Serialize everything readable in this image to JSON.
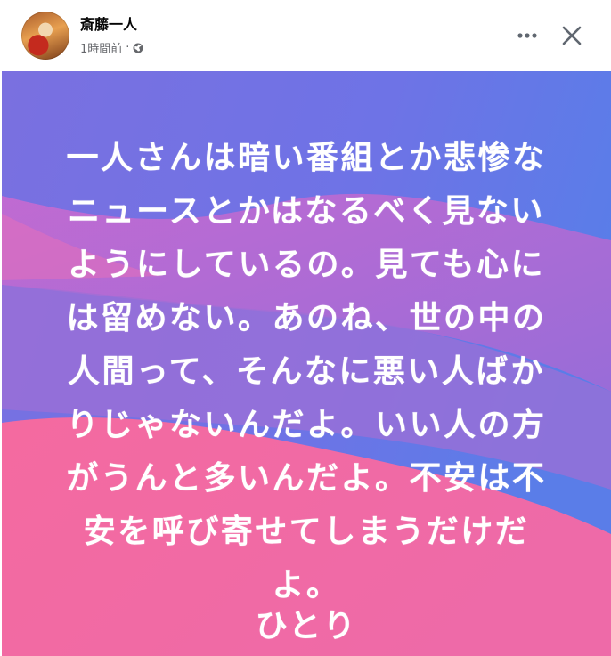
{
  "header": {
    "author_name": "斎藤一人",
    "timestamp": "1時間前",
    "separator": "·",
    "privacy_icon": "globe-icon",
    "more_icon": "more-horizontal-icon",
    "close_icon": "close-icon"
  },
  "post_image": {
    "lines": [
      "一人さんは暗い番組とか悲惨な",
      "ニュースとかはなるべく見ない",
      "ようにしているの。見ても心に",
      "は留めない。あのね、世の中の",
      "人間って、そんなに悪い人ばか",
      "りじゃないんだよ。いい人の方",
      "がうんと多いんだよ。不安は不",
      "安を呼び寄せてしまうだけだ",
      "よ。"
    ],
    "signature": "ひとり",
    "colors": {
      "blue": "#6f6fe3",
      "purple": "#9b6bd4",
      "pink": "#f2679f",
      "text": "#ffffff"
    }
  }
}
